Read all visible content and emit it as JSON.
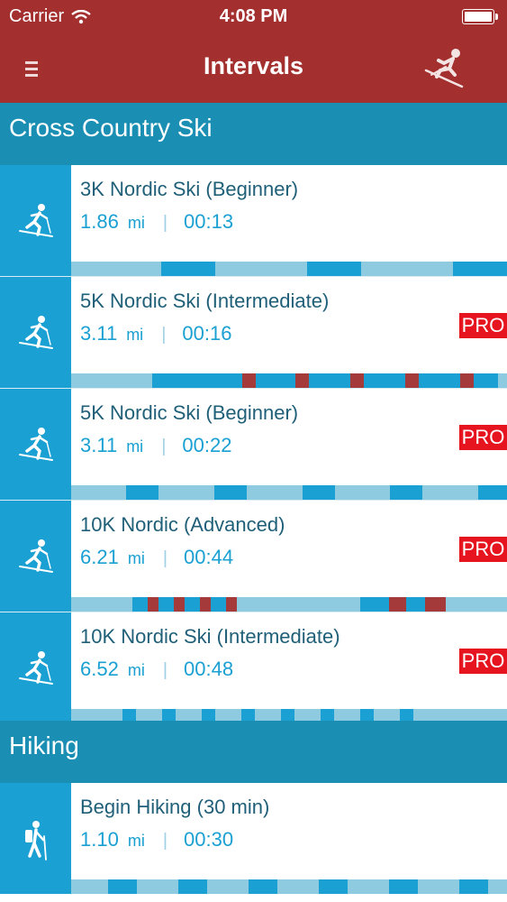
{
  "status_bar": {
    "carrier": "Carrier",
    "time": "4:08 PM"
  },
  "nav": {
    "title": "Intervals",
    "menu_icon": "menu-icon",
    "action_icon": "skier-icon"
  },
  "colors": {
    "nav_background": "#a32f2f",
    "section_background": "#1a8fb3",
    "icon_background": "#1aa0d2",
    "bar_light": "#8fcbe0",
    "bar_fast": "#1aa0d2",
    "bar_hard": "#a53a3a",
    "pro_badge": "#e5141e",
    "title_text": "#1f5f78"
  },
  "sections": [
    {
      "title": "Cross Country Ski",
      "workouts": [
        {
          "name": "3K Nordic Ski (Beginner)",
          "distance": "1.86",
          "unit": "mi",
          "duration": "00:13",
          "pro": "",
          "icon": "cross-country-ski-icon",
          "intervals": [
            [
              "light",
              0.207
            ],
            [
              "fast",
              0.124
            ],
            [
              "light",
              0.211
            ],
            [
              "fast",
              0.124
            ],
            [
              "light",
              0.211
            ],
            [
              "fast",
              0.124
            ]
          ]
        },
        {
          "name": "5K Nordic Ski (Intermediate)",
          "distance": "3.11",
          "unit": "mi",
          "duration": "00:16",
          "pro": "PRO",
          "icon": "cross-country-ski-icon",
          "intervals": [
            [
              "light",
              0.186
            ],
            [
              "fast",
              0.207
            ],
            [
              "hard",
              0.031
            ],
            [
              "fast",
              0.091
            ],
            [
              "hard",
              0.031
            ],
            [
              "fast",
              0.095
            ],
            [
              "hard",
              0.031
            ],
            [
              "fast",
              0.095
            ],
            [
              "hard",
              0.031
            ],
            [
              "fast",
              0.095
            ],
            [
              "hard",
              0.031
            ],
            [
              "fast",
              0.056
            ]
          ]
        },
        {
          "name": "5K Nordic Ski (Beginner)",
          "distance": "3.11",
          "unit": "mi",
          "duration": "00:22",
          "pro": "PRO",
          "icon": "cross-country-ski-icon",
          "intervals": [
            [
              "light",
              0.126
            ],
            [
              "fast",
              0.074
            ],
            [
              "light",
              0.128
            ],
            [
              "fast",
              0.074
            ],
            [
              "light",
              0.128
            ],
            [
              "fast",
              0.074
            ],
            [
              "light",
              0.128
            ],
            [
              "fast",
              0.074
            ],
            [
              "light",
              0.128
            ],
            [
              "fast",
              0.066
            ]
          ]
        },
        {
          "name": "10K Nordic (Advanced)",
          "distance": "6.21",
          "unit": "mi",
          "duration": "00:44",
          "pro": "PRO",
          "icon": "cross-country-ski-icon",
          "intervals": [
            [
              "light",
              0.14
            ],
            [
              "fast",
              0.035
            ],
            [
              "hard",
              0.025
            ],
            [
              "fast",
              0.035
            ],
            [
              "hard",
              0.025
            ],
            [
              "fast",
              0.035
            ],
            [
              "hard",
              0.025
            ],
            [
              "fast",
              0.035
            ],
            [
              "hard",
              0.025
            ],
            [
              "light",
              0.283
            ],
            [
              "fast",
              0.066
            ],
            [
              "hard",
              0.039
            ],
            [
              "fast",
              0.045
            ],
            [
              "hard",
              0.048
            ],
            [
              "light",
              0.139
            ]
          ]
        },
        {
          "name": "10K Nordic Ski (Intermediate)",
          "distance": "6.52",
          "unit": "mi",
          "duration": "00:48",
          "pro": "PRO",
          "icon": "cross-country-ski-icon",
          "intervals": [
            [
              "light",
              0.118
            ],
            [
              "fast",
              0.031
            ],
            [
              "light",
              0.06
            ],
            [
              "fast",
              0.031
            ],
            [
              "light",
              0.06
            ],
            [
              "fast",
              0.031
            ],
            [
              "light",
              0.06
            ],
            [
              "fast",
              0.031
            ],
            [
              "light",
              0.06
            ],
            [
              "fast",
              0.031
            ],
            [
              "light",
              0.06
            ],
            [
              "fast",
              0.031
            ],
            [
              "light",
              0.06
            ],
            [
              "fast",
              0.031
            ],
            [
              "light",
              0.06
            ],
            [
              "fast",
              0.031
            ],
            [
              "light",
              0.103
            ]
          ]
        }
      ]
    },
    {
      "title": "Hiking",
      "workouts": [
        {
          "name": "Begin Hiking (30 min)",
          "distance": "1.10",
          "unit": "mi",
          "duration": "00:30",
          "pro": "",
          "icon": "hiking-icon",
          "intervals": [
            [
              "light",
              0.085
            ],
            [
              "fast",
              0.066
            ],
            [
              "light",
              0.095
            ],
            [
              "fast",
              0.066
            ],
            [
              "light",
              0.095
            ],
            [
              "fast",
              0.066
            ],
            [
              "light",
              0.095
            ],
            [
              "fast",
              0.066
            ],
            [
              "light",
              0.095
            ],
            [
              "fast",
              0.066
            ],
            [
              "light",
              0.095
            ],
            [
              "fast",
              0.066
            ],
            [
              "light",
              0.039
            ]
          ]
        }
      ]
    }
  ]
}
